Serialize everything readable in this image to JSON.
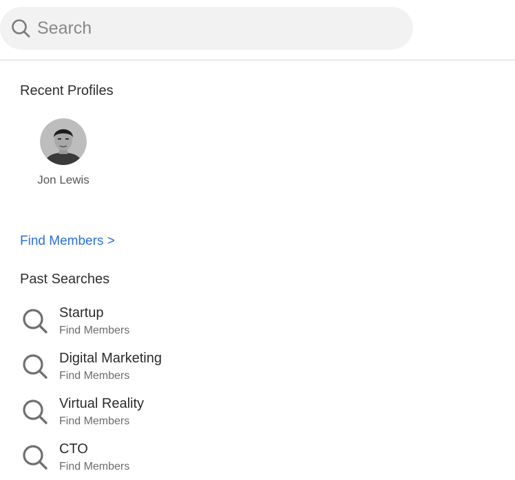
{
  "search": {
    "placeholder": "Search"
  },
  "recent_profiles": {
    "title": "Recent Profiles",
    "items": [
      {
        "name": "Jon Lewis"
      }
    ]
  },
  "find_members_link": "Find Members >",
  "past_searches": {
    "title": "Past Searches",
    "items": [
      {
        "term": "Startup",
        "subtitle": "Find Members"
      },
      {
        "term": "Digital Marketing",
        "subtitle": "Find Members"
      },
      {
        "term": "Virtual Reality",
        "subtitle": "Find Members"
      },
      {
        "term": "CTO",
        "subtitle": "Find Members"
      }
    ]
  },
  "colors": {
    "link": "#2a6fdb",
    "search_bg": "#f2f2f2",
    "icon": "#6f6f6f"
  },
  "icons": {
    "search": "search-icon"
  }
}
